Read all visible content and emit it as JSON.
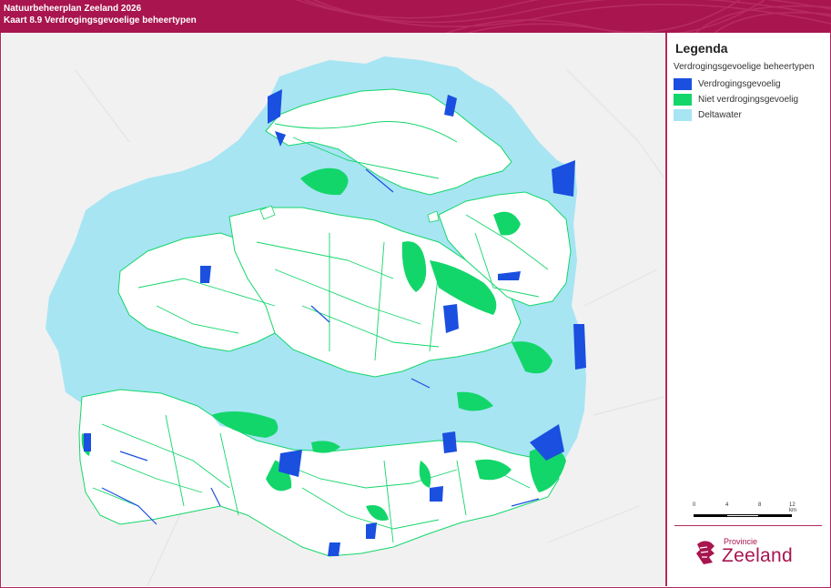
{
  "header": {
    "line1": "Natuurbeheerplan Zeeland 2026",
    "line2": "Kaart 8.9 Verdrogingsgevoelige beheertypen",
    "color": "#a8154f"
  },
  "legend": {
    "title": "Legenda",
    "subtitle": "Verdrogingsgevoelige beheertypen",
    "items": [
      {
        "label": "Verdrogingsgevoelig",
        "color": "#1a4fe0"
      },
      {
        "label": "Niet verdrogingsgevoelig",
        "color": "#13d66a"
      },
      {
        "label": "Deltawater",
        "color": "#a7e5f3"
      }
    ]
  },
  "scale": {
    "ticks": [
      "0",
      "4",
      "8",
      "12 km"
    ]
  },
  "logo": {
    "sub": "Provincie",
    "name": "Zeeland"
  },
  "colors": {
    "background": "#f1f1f1",
    "land": "#ffffff",
    "frame": "#b0285e"
  }
}
